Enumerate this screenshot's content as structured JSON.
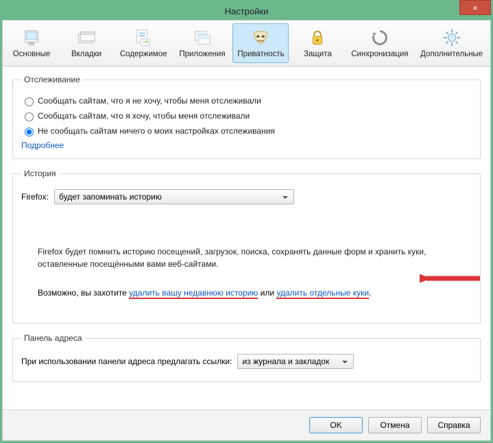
{
  "window": {
    "title": "Настройки",
    "close_label": "×"
  },
  "tabs": [
    {
      "label": "Основные"
    },
    {
      "label": "Вкладки"
    },
    {
      "label": "Содержимое"
    },
    {
      "label": "Приложения"
    },
    {
      "label": "Приватность"
    },
    {
      "label": "Защита"
    },
    {
      "label": "Синхронизация"
    },
    {
      "label": "Дополнительные"
    }
  ],
  "tracking": {
    "legend": "Отслеживание",
    "option1": "Сообщать сайтам, что я не хочу, чтобы меня отслеживали",
    "option2": "Сообщать сайтам, что я хочу, чтобы меня отслеживали",
    "option3": "Не сообщать сайтам ничего о моих настройках отслеживания",
    "more_link": "Подробнее"
  },
  "history": {
    "legend": "История",
    "prefix": "Firefox:",
    "mode": "будет запоминать историю",
    "desc": "Firefox будет помнить историю посещений, загрузок, поиска, сохранять данные форм и хранить куки, оставленные посещёнными вами веб-сайтами.",
    "action_prefix": "Возможно, вы захотите ",
    "action_link1": "удалить вашу недавнюю историю",
    "action_mid": " или ",
    "action_link2": "удалить отдельные куки",
    "action_suffix": "."
  },
  "addressbar": {
    "legend": "Панель адреса",
    "label": "При использовании панели адреса предлагать ссылки:",
    "mode": "из журнала и закладок"
  },
  "buttons": {
    "ok": "OK",
    "cancel": "Отмена",
    "help": "Справка"
  }
}
